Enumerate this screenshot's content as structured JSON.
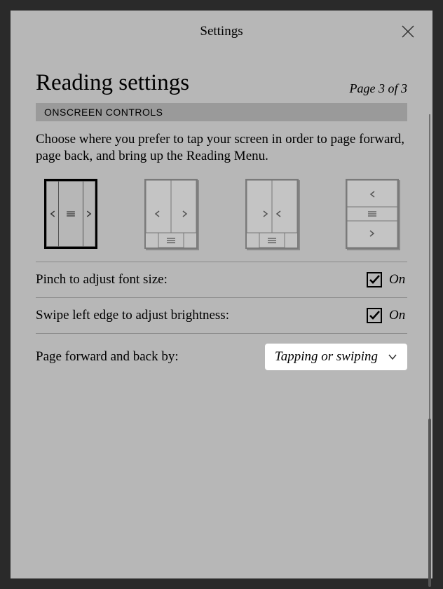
{
  "header": {
    "title": "Settings"
  },
  "page": {
    "title": "Reading settings",
    "page_of": "Page 3 of 3"
  },
  "section": {
    "name": "ONSCREEN CONTROLS",
    "desc": "Choose where you prefer to tap your screen in order to page forward, page back, and bring up the Reading Menu."
  },
  "rows": {
    "pinch": {
      "label": "Pinch to adjust font size:",
      "state": "On"
    },
    "swipe": {
      "label": "Swipe left edge to adjust brightness:",
      "state": "On"
    },
    "pagefwd": {
      "label": "Page forward and back by:",
      "dropdown": "Tapping or swiping"
    }
  }
}
